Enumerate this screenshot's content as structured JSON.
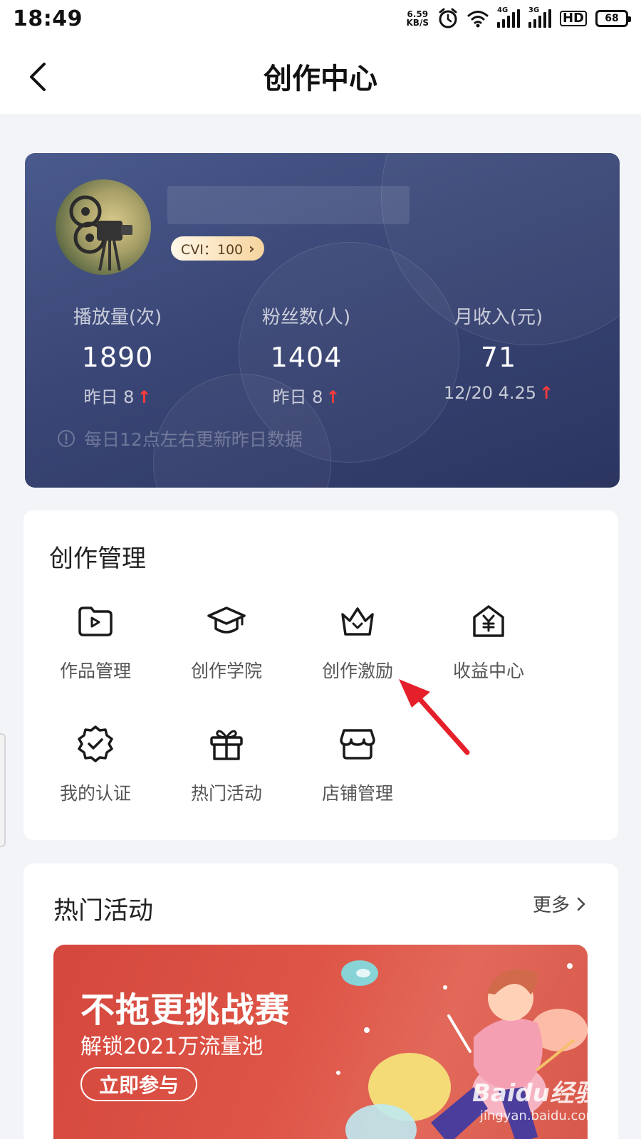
{
  "status_bar": {
    "time": "18:49",
    "net_speed_value": "6.59",
    "net_speed_unit": "KB/S",
    "signal_1_tag": "4G",
    "signal_2_tag": "3G",
    "hd": "HD",
    "battery": "68"
  },
  "header": {
    "title": "创作中心"
  },
  "profile": {
    "cvi_label": "CVI：100",
    "stats": [
      {
        "label": "播放量(次)",
        "value": "1890",
        "change": "昨日 8"
      },
      {
        "label": "粉丝数(人)",
        "value": "1404",
        "change": "昨日 8"
      },
      {
        "label": "月收入(元)",
        "value": "71",
        "change": "12/20 4.25"
      }
    ],
    "update_note": "每日12点左右更新昨日数据"
  },
  "creation_management": {
    "title": "创作管理",
    "items": [
      {
        "label": "作品管理",
        "icon": "video-folder-icon"
      },
      {
        "label": "创作学院",
        "icon": "graduation-cap-icon"
      },
      {
        "label": "创作激励",
        "icon": "crown-icon"
      },
      {
        "label": "收益中心",
        "icon": "yen-house-icon"
      },
      {
        "label": "我的认证",
        "icon": "verified-badge-icon"
      },
      {
        "label": "热门活动",
        "icon": "gift-icon"
      },
      {
        "label": "店铺管理",
        "icon": "shop-icon"
      }
    ]
  },
  "hot_activities": {
    "title": "热门活动",
    "more_label": "更多",
    "banner": {
      "title": "不拖更挑战赛",
      "subtitle": "解锁2021万流量池",
      "button_label": "立即参与"
    }
  },
  "watermark": {
    "logo": "Baidu经验",
    "url": "jingyan.baidu.com"
  },
  "colors": {
    "profile_card": "#3a4676",
    "banner": "#d94e43",
    "accent_up": "#ff3b3b",
    "annotation": "#e5202a"
  }
}
